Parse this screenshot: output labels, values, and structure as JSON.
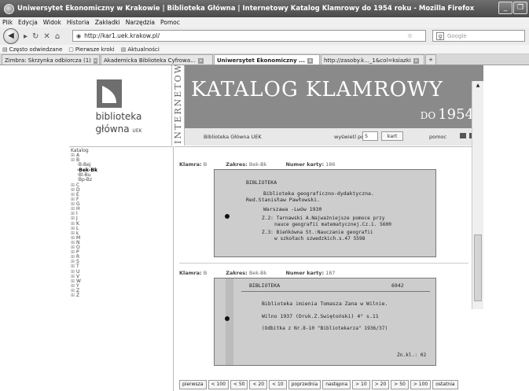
{
  "window": {
    "title": "Uniwersytet Ekonomiczny w Krakowie | Biblioteka Główna | Internetowy Katalog Klamrowy do 1954 roku - Mozilla Firefox",
    "minimize": "_",
    "restore": "❐"
  },
  "menu": [
    "Plik",
    "Edycja",
    "Widok",
    "Historia",
    "Zakładki",
    "Narzędzia",
    "Pomoc"
  ],
  "nav": {
    "url": "http://kar1.uek.krakow.pl/",
    "search_placeholder": "Google",
    "search_engine_glyph": "g"
  },
  "bookmarks": [
    "Często odwiedzane",
    "Pierwsze kroki",
    "Aktualności"
  ],
  "tabs": [
    {
      "label": "Zimbra: Skrzynka odbiorcza (1)",
      "active": false
    },
    {
      "label": "Akademicka Biblioteka Cyfrowa...",
      "active": false
    },
    {
      "label": "Uniwersytet Ekonomiczny ...",
      "active": true
    },
    {
      "label": "http://zasoby.k..._1&col=ksiazki",
      "active": false
    }
  ],
  "newtab_label": "+",
  "logo": {
    "line1": "biblioteka",
    "line2": "główna",
    "line2_small": "UEK"
  },
  "vertical_text": "INTERNETOWY",
  "banner": {
    "title": "KATALOG KLAMROWY",
    "year_prefix": "DO",
    "year": "1954"
  },
  "subbar": {
    "library": "Biblioteka Główna UEK",
    "per_page_label": "wyświetl po:",
    "per_page_value": "5",
    "unit_button": "kart",
    "help": "pomoc"
  },
  "tree": {
    "root": "Katalog",
    "before": [
      "A",
      "B"
    ],
    "b_children": [
      "B-Bej",
      "Bek-Bk",
      "Bl-Bu",
      "Bp-Bz"
    ],
    "selected_child": "Bek-Bk",
    "after": [
      "C",
      "D",
      "E",
      "F",
      "G",
      "H",
      "I",
      "J",
      "K",
      "L",
      "Ł",
      "M",
      "N",
      "O",
      "P",
      "R",
      "S",
      "T",
      "U",
      "V",
      "W",
      "Y",
      "Z",
      "Ż"
    ]
  },
  "cards": [
    {
      "klamra_label": "Klamra:",
      "klamra": "B",
      "zakres_label": "Zakres:",
      "zakres": "Bek-Bk",
      "numer_label": "Numer karty:",
      "numer": "186",
      "lines": [
        "BIBLIOTEKA",
        "Biblioteka geograficzno-dydaktyczna.",
        "Red.Stanisław Pawłowski.",
        "Warszawa -Lwów 1930",
        "Z.2: Tarnawski A.Najważniejsze pomoce przy",
        "nauce geografii matematycznej.Cz.1.  5600",
        "Z.3: Bieńkówna St.:Nauczanie geografii",
        "w szkołach szwedzkich.s.47        5598"
      ]
    },
    {
      "klamra_label": "Klamra:",
      "klamra": "B",
      "zakres_label": "Zakres:",
      "zakres": "Bek-Bk",
      "numer_label": "Numer karty:",
      "numer": "187",
      "lines": [
        "BIBLIOTEKA",
        "6942",
        "Biblioteka imienia Tomasza Zana w Wilnie.",
        "Wilno 1937 (Druk.Z.Swiętoński) 4° s.11",
        "(Odbitka z Nr.8-10 \"Bibliotekarza\" 1936/37)",
        "Zn.kl.: 02"
      ]
    }
  ],
  "pager": [
    "pierwsza",
    "< 100",
    "< 50",
    "< 20",
    "< 10",
    "poprzednia",
    "następna",
    "> 10",
    "> 20",
    "> 50",
    "> 100",
    "ostatnia"
  ]
}
